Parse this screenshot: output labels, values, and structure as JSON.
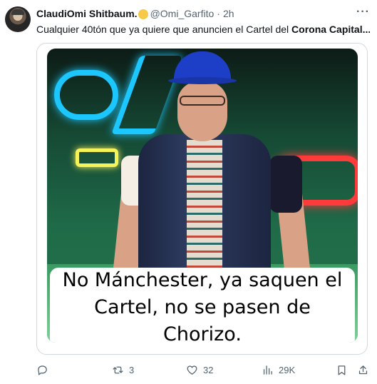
{
  "tweet": {
    "author_name": "ClaudiOmi Shitbaum.",
    "handle": "@Omi_Garfito",
    "separator": "·",
    "time": "2h",
    "more_label": "···",
    "text_normal": "Cualquier 40tón que ya quiere que anuncien el Cartel del ",
    "text_bold": "Corona Capital..."
  },
  "media": {
    "caption": "No Mánchester, ya saquen el Cartel, no se pasen de Chorizo."
  },
  "actions": {
    "reply_icon": "reply-icon",
    "retweet_icon": "retweet-icon",
    "retweet_count": "3",
    "like_icon": "heart-icon",
    "like_count": "32",
    "views_icon": "views-icon",
    "views_count": "29K",
    "bookmark_icon": "bookmark-icon",
    "share_icon": "share-icon"
  },
  "colors": {
    "text_primary": "#0f1419",
    "text_secondary": "#536471",
    "border": "#cfd9de"
  }
}
